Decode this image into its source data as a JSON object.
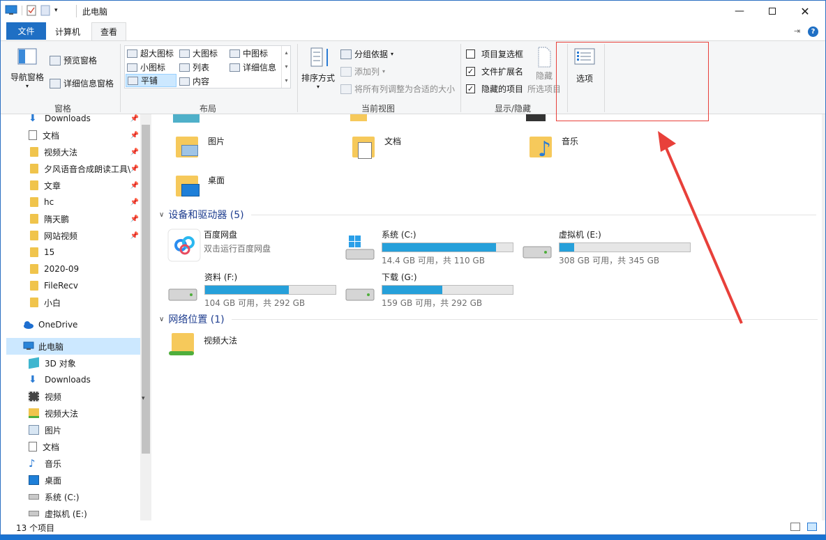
{
  "window": {
    "title": "此电脑",
    "controls": [
      "minimize-icon",
      "maximize-icon",
      "close-icon"
    ]
  },
  "tabs": {
    "file": "文件",
    "computer": "计算机",
    "view": "查看"
  },
  "ribbon": {
    "pane": {
      "nav_pane": "导航窗格",
      "preview_pane": "预览窗格",
      "details_pane": "详细信息窗格",
      "group": "窗格"
    },
    "layout": {
      "extra_large": "超大图标",
      "large": "大图标",
      "medium": "中图标",
      "small": "小图标",
      "list": "列表",
      "details": "详细信息",
      "tiles": "平铺",
      "content": "内容",
      "group": "布局"
    },
    "current_view": {
      "sort_by": "排序方式",
      "group_by": "分组依据",
      "add_columns": "添加列",
      "size_all_columns": "将所有列调整为合适的大小",
      "group": "当前视图"
    },
    "show_hide": {
      "item_checkboxes": "项目复选框",
      "item_checkboxes_checked": false,
      "file_extensions": "文件扩展名",
      "file_extensions_checked": true,
      "hidden_items": "隐藏的项目",
      "hidden_items_checked": true,
      "hide": "隐藏",
      "selected_items": "所选项目",
      "group": "显示/隐藏"
    },
    "options": "选项"
  },
  "nav": {
    "items": [
      {
        "label": "Downloads",
        "icon": "download-icon",
        "pinned": true
      },
      {
        "label": "文档",
        "icon": "document-icon",
        "pinned": true
      },
      {
        "label": "视频大法",
        "icon": "folder-icon",
        "pinned": true
      },
      {
        "label": "夕风语音合成朗读工具\\",
        "icon": "folder-icon",
        "pinned": true
      },
      {
        "label": "文章",
        "icon": "folder-icon",
        "pinned": true
      },
      {
        "label": "hc",
        "icon": "folder-icon",
        "pinned": true
      },
      {
        "label": "隋天鹏",
        "icon": "folder-icon",
        "pinned": true
      },
      {
        "label": "网站视频",
        "icon": "folder-icon",
        "pinned": true
      },
      {
        "label": "15",
        "icon": "folder-icon",
        "pinned": false
      },
      {
        "label": "2020-09",
        "icon": "folder-icon",
        "pinned": false
      },
      {
        "label": "FileRecv",
        "icon": "folder-icon",
        "pinned": false
      },
      {
        "label": "小白",
        "icon": "folder-icon",
        "pinned": false
      }
    ],
    "onedrive": "OneDrive",
    "this_pc": "此电脑",
    "pc_items": [
      {
        "label": "3D 对象",
        "icon": "cube-icon"
      },
      {
        "label": "Downloads",
        "icon": "download-icon"
      },
      {
        "label": "视频",
        "icon": "video-icon"
      },
      {
        "label": "视频大法",
        "icon": "network-folder-icon"
      },
      {
        "label": "图片",
        "icon": "picture-icon"
      },
      {
        "label": "文档",
        "icon": "document-icon"
      },
      {
        "label": "音乐",
        "icon": "music-icon"
      },
      {
        "label": "桌面",
        "icon": "desktop-icon"
      },
      {
        "label": "系统 (C:)",
        "icon": "drive-icon"
      },
      {
        "label": "虚拟机 (E:)",
        "icon": "drive-icon"
      }
    ]
  },
  "folders": [
    {
      "label": "图片",
      "icon": "picture-folder-icon"
    },
    {
      "label": "文档",
      "icon": "document-folder-icon"
    },
    {
      "label": "音乐",
      "icon": "music-folder-icon"
    },
    {
      "label": "桌面",
      "icon": "desktop-folder-icon"
    }
  ],
  "devices": {
    "header": "设备和驱动器 (5)",
    "baidu": {
      "name": "百度网盘",
      "desc": "双击运行百度网盘"
    },
    "drives": [
      {
        "name": "系统 (C:)",
        "free": "14.4 GB 可用，共 110 GB",
        "used_fraction": 0.87
      },
      {
        "name": "虚拟机 (E:)",
        "free": "308 GB 可用，共 345 GB",
        "used_fraction": 0.11
      },
      {
        "name": "资料 (F:)",
        "free": "104 GB 可用，共 292 GB",
        "used_fraction": 0.64
      },
      {
        "name": "下载 (G:)",
        "free": "159 GB 可用，共 292 GB",
        "used_fraction": 0.46
      }
    ]
  },
  "network": {
    "header": "网络位置 (1)",
    "items": [
      {
        "label": "视频大法",
        "icon": "network-folder-icon"
      }
    ]
  },
  "status": {
    "count": "13 个项目"
  },
  "colors": {
    "accent": "#1f6fc4",
    "drive_bar": "#26a0da",
    "annotation": "#e8403a"
  }
}
